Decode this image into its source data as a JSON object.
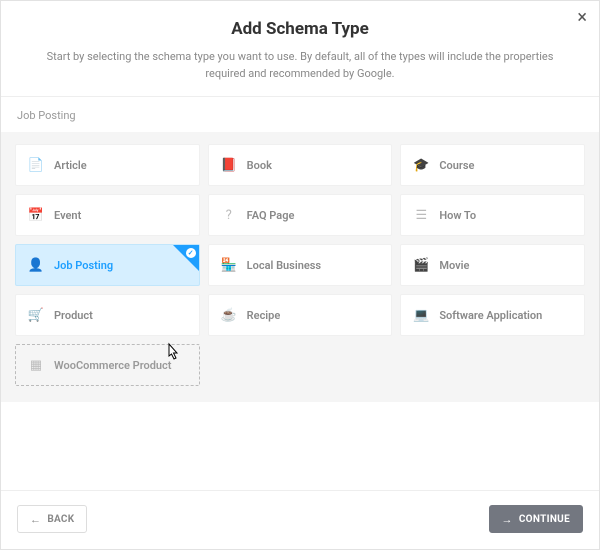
{
  "header": {
    "title": "Add Schema Type",
    "subtitle": "Start by selecting the schema type you want to use. By default, all of the types will include the properties required and recommended by Google."
  },
  "section_label": "Job Posting",
  "types": [
    {
      "id": "article",
      "label": "Article",
      "glyph": "📄",
      "selected": false,
      "variant": "normal"
    },
    {
      "id": "book",
      "label": "Book",
      "glyph": "📕",
      "selected": false,
      "variant": "normal"
    },
    {
      "id": "course",
      "label": "Course",
      "glyph": "🎓",
      "selected": false,
      "variant": "normal"
    },
    {
      "id": "event",
      "label": "Event",
      "glyph": "📅",
      "selected": false,
      "variant": "normal"
    },
    {
      "id": "faq-page",
      "label": "FAQ Page",
      "glyph": "?",
      "selected": false,
      "variant": "normal"
    },
    {
      "id": "how-to",
      "label": "How To",
      "glyph": "☰",
      "selected": false,
      "variant": "normal"
    },
    {
      "id": "job-posting",
      "label": "Job Posting",
      "glyph": "👤",
      "selected": true,
      "variant": "normal"
    },
    {
      "id": "local-business",
      "label": "Local Business",
      "glyph": "🏪",
      "selected": false,
      "variant": "normal"
    },
    {
      "id": "movie",
      "label": "Movie",
      "glyph": "🎬",
      "selected": false,
      "variant": "normal"
    },
    {
      "id": "product",
      "label": "Product",
      "glyph": "🛒",
      "selected": false,
      "variant": "normal"
    },
    {
      "id": "recipe",
      "label": "Recipe",
      "glyph": "☕",
      "selected": false,
      "variant": "normal"
    },
    {
      "id": "software-application",
      "label": "Software Application",
      "glyph": "💻",
      "selected": false,
      "variant": "normal"
    },
    {
      "id": "woocommerce-product",
      "label": "WooCommerce Product",
      "glyph": "▦",
      "selected": false,
      "variant": "dashed"
    }
  ],
  "footer": {
    "back_label": "BACK",
    "continue_label": "CONTINUE"
  }
}
